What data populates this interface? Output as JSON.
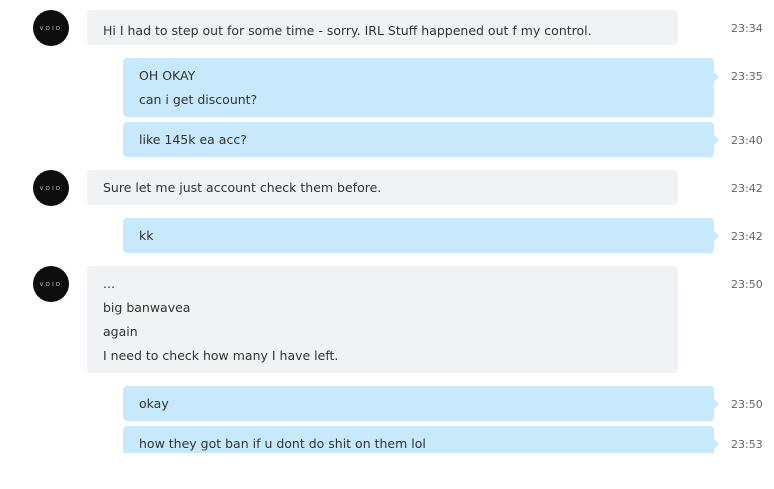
{
  "avatar": {
    "text": "VOID"
  },
  "messages": [
    {
      "direction": "incoming",
      "lines": [
        "Hi I had to step out for some time - sorry. IRL Stuff happened out f my control."
      ],
      "time": "23:34"
    },
    {
      "direction": "outgoing",
      "lines": [
        "OH OKAY",
        "can i get discount?"
      ],
      "time": "23:35"
    },
    {
      "direction": "outgoing",
      "lines": [
        "like 145k ea acc?"
      ],
      "time": "23:40"
    },
    {
      "direction": "incoming",
      "lines": [
        "Sure let me just account check them before."
      ],
      "time": "23:42"
    },
    {
      "direction": "outgoing",
      "lines": [
        "kk"
      ],
      "time": "23:42"
    },
    {
      "direction": "incoming",
      "lines": [
        "...",
        "big banwavea",
        "again",
        "I need to check how many I have left."
      ],
      "time": "23:50"
    },
    {
      "direction": "outgoing",
      "lines": [
        "okay"
      ],
      "time": "23:50"
    },
    {
      "direction": "outgoing",
      "lines": [
        "how they got ban if u dont do shit on them lol"
      ],
      "time": "23:53"
    }
  ]
}
